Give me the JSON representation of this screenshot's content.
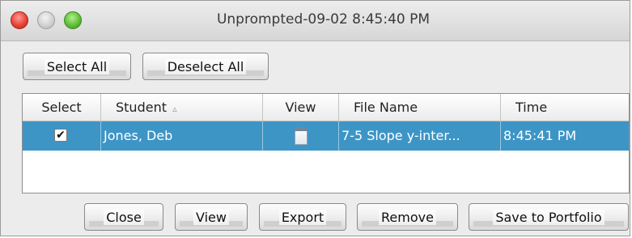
{
  "window": {
    "title": "Unprompted-09-02 8:45:40 PM"
  },
  "toolbar": {
    "select_all_label": "Select All",
    "deselect_all_label": "Deselect All"
  },
  "table": {
    "headers": {
      "select": "Select",
      "student": "Student",
      "student_sort": "▵",
      "view": "View",
      "file_name": "File Name",
      "time": "Time"
    },
    "rows": [
      {
        "selected": true,
        "check_mark": "✔",
        "student": "Jones, Deb",
        "view_icon": "document-icon",
        "file_name": "7-5 Slope y-inter...",
        "time": "8:45:41 PM"
      }
    ]
  },
  "footer": {
    "close_label": "Close",
    "view_label": "View",
    "export_label": "Export",
    "remove_label": "Remove",
    "save_label": "Save to Portfolio"
  },
  "colors": {
    "selection": "#3d95c6",
    "close_light": "#e8433a",
    "zoom_light": "#5fbf3a"
  }
}
